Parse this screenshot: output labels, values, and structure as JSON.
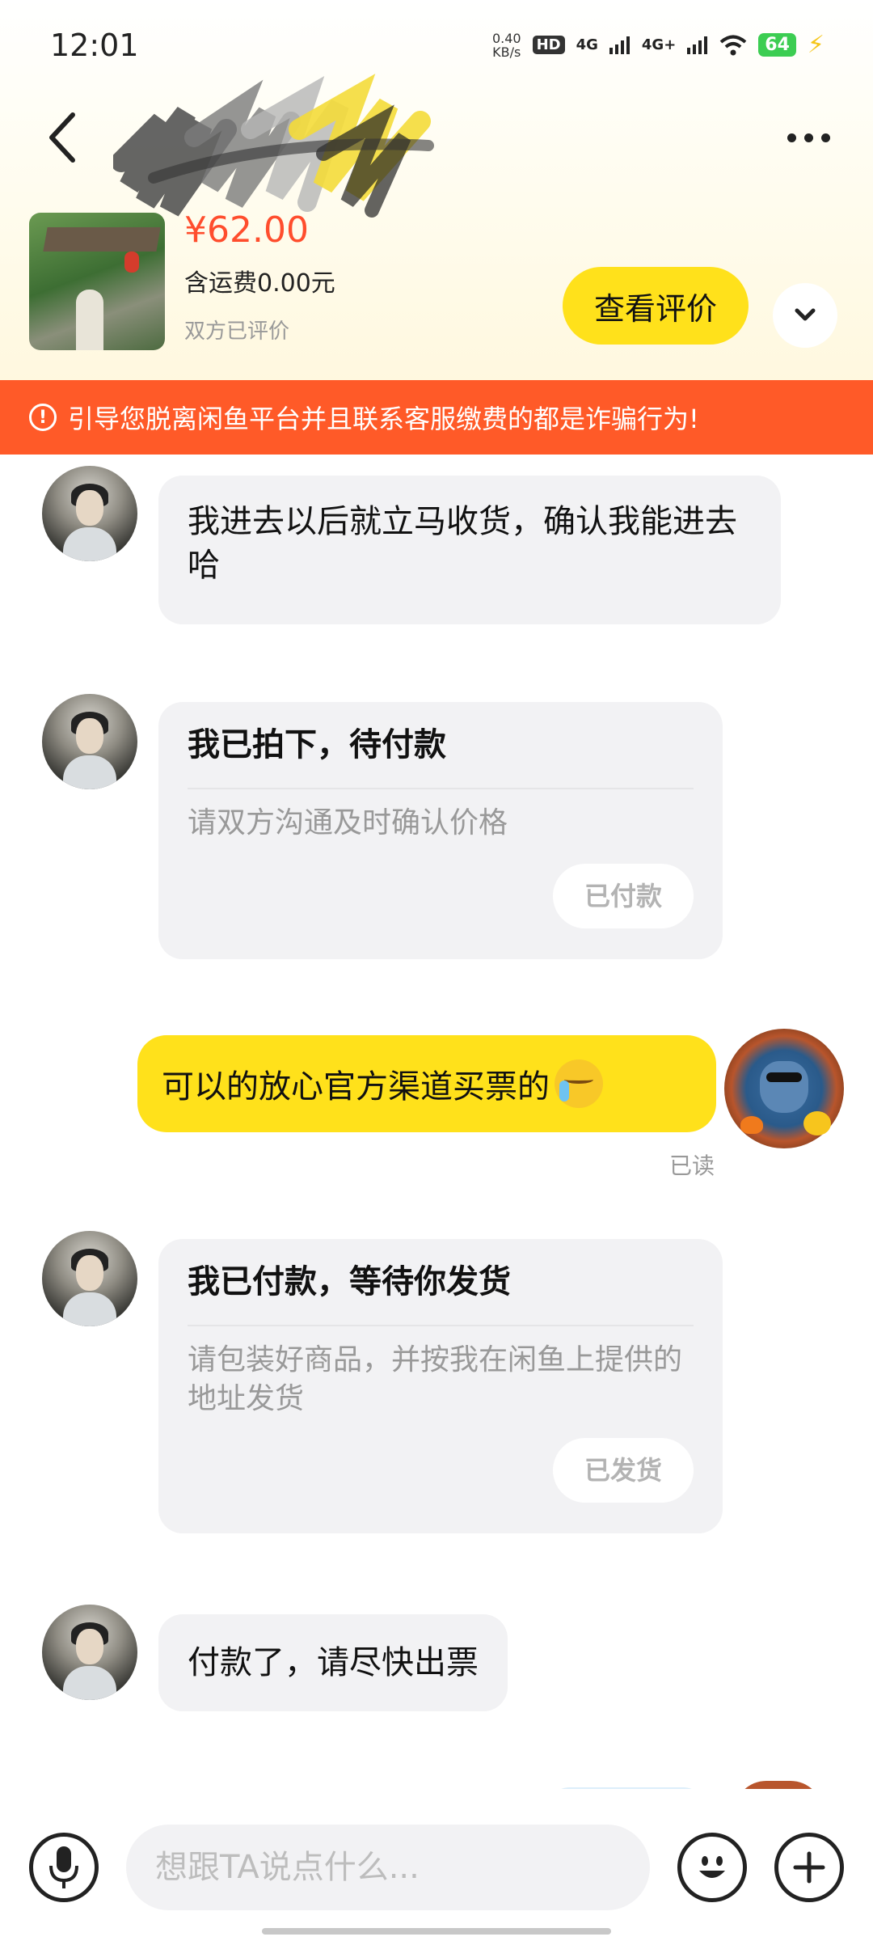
{
  "status_bar": {
    "time": "12:01",
    "net_speed_value": "0.40",
    "net_speed_unit": "KB/s",
    "hd_label": "HD",
    "signal_1": "4G",
    "signal_2": "4G+",
    "battery": "64"
  },
  "header": {
    "back_icon": "chevron-left-icon",
    "more_icon": "more-dots-icon"
  },
  "product": {
    "price": "¥62.00",
    "shipping": "含运费0.00元",
    "review_status": "双方已评价",
    "view_review_label": "查看评价"
  },
  "warning": {
    "text": "引导您脱离闲鱼平台并且联系客服缴费的都是诈骗行为!"
  },
  "messages": {
    "msg1": "我进去以后就立马收货，确认我能进去哈",
    "order_card_1": {
      "title": "我已拍下，待付款",
      "desc": "请双方沟通及时确认价格",
      "button": "已付款"
    },
    "msg_self": "可以的放心官方渠道买票的",
    "read_status": "已读",
    "order_card_2": {
      "title": "我已付款，等待你发货",
      "desc": "请包装好商品，并按我在闲鱼上提供的地址发货",
      "button": "已发货"
    },
    "msg2": "付款了，请尽快出票"
  },
  "input_bar": {
    "placeholder": "想跟TA说点什么...",
    "voice_icon": "microphone-icon",
    "emoji_icon": "smiley-icon",
    "plus_icon": "plus-icon"
  },
  "colors": {
    "accent_yellow": "#ffe11b",
    "warning_orange": "#ff5a28",
    "price_red": "#ff4d2d"
  }
}
